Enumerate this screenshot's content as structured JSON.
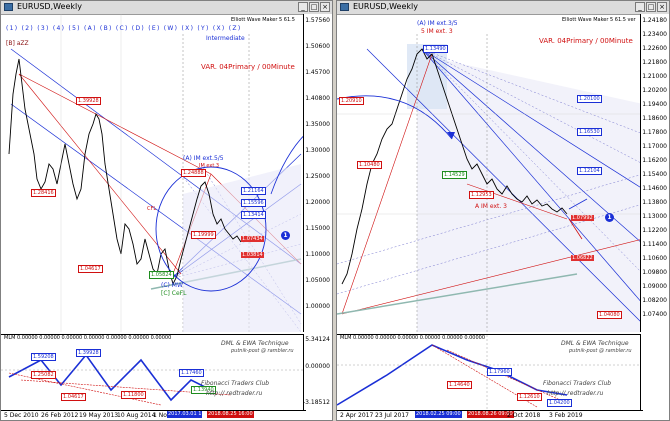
{
  "colors": {
    "blue": "#1a2fd6",
    "red": "#d01010",
    "green": "#1e8c1e",
    "teal": "#8fb8b0",
    "darkred": "#8a1010",
    "navy": "#1a1a8c"
  },
  "left": {
    "title": "EURUSD,Weekly",
    "elliott": "Elliott Wave Maker 5 61.5",
    "wave_labels": "(1) (2) (3) (4) (5) (A) (B) (C) (D) (E) (W) (X) (Y) (X) (Z)",
    "intermediate": "Intermediate",
    "top_marker": "[B] aZZ",
    "var": "VAR. 04Primary / 00Minute",
    "im_label": "(A) IM ext.5/5",
    "im_label2": "IM ext.3",
    "cmw": "(C) MW",
    "cefl": "[C] CeFL",
    "cfl": "CFL",
    "price_axis": [
      "1.57560",
      "1.50600",
      "1.45700",
      "1.40800",
      "1.35000",
      "1.30000",
      "1.25000",
      "1.20000",
      "1.15000",
      "1.10000",
      "1.05000",
      "1.00000"
    ],
    "price_labels": {
      "p1": "1.39928",
      "p2": "1.28416",
      "p3": "1.24888",
      "p4": "1.21164",
      "p5": "1.15596",
      "p6": "1.04617",
      "p7": "1.13414",
      "p8": "1.05824",
      "p9": "1.07434",
      "p10": "1.03814",
      "p11": "1.19999"
    },
    "indicator": "MLM 0.00000 0.00000 0.00000 0.00000 0.00000 0.00000 0.00000",
    "ind_axis": [
      "5.34124",
      "0.00000",
      "-3.18512"
    ],
    "osc_labels": {
      "o1": "1.59208",
      "o2": "1.39928",
      "o3": "1.17460",
      "o4": "1.13940",
      "o5": "1.25082",
      "o6": "1.04617",
      "o7": "1.11800"
    },
    "watermark1": "DML & EWA Technique",
    "watermark2": "putnik-post @ rambler.ru",
    "club": "Fibonacci Traders Club",
    "site": "http:// redtrader.ru",
    "dates": [
      "5 Dec 2010",
      "26 Feb 2012",
      "19 May 2013",
      "10 Aug 2014",
      "1 No"
    ],
    "date_hl1": "2017.03.01 1",
    "date_hl2": "2018.08.25 16:00",
    "marker1": "1"
  },
  "right": {
    "title": "EURUSD,Weekly",
    "elliott": "Elliott Wave Maker 5 61.5 ver",
    "im_label": "(A) IM ext.3/5",
    "im_sub": "5 IM ext. 3",
    "var": "VAR. 04Primary / 00Minute",
    "a_label": "A IM ext. 3",
    "price_axis": [
      "1.24180",
      "1.23400",
      "1.22600",
      "1.21800",
      "1.21000",
      "1.20200",
      "1.19400",
      "1.18600",
      "1.17800",
      "1.17000",
      "1.16200",
      "1.15400",
      "1.14600",
      "1.13800",
      "1.13000",
      "1.12200",
      "1.11400",
      "1.10600",
      "1.09800",
      "1.09000",
      "1.08200",
      "1.07400"
    ],
    "price_labels": {
      "p1": "1.20910",
      "p2": "1.20100",
      "p3": "1.16530",
      "p4": "1.12953",
      "p5": "1.14529",
      "p6": "1.10480",
      "p7": "1.13490",
      "p8": "1.12104",
      "p9": "1.07992",
      "p10": "1.06822",
      "p11": "1.04080"
    },
    "indicator": "MLM 0.00000 0.00000 0.00000 0.00000 0.00000 0.00000",
    "watermark1": "DML & EWA Technique",
    "watermark2": "putnik-post @ rambler.ru",
    "club": "Fibonacci Traders Club",
    "site": "http:// redtrader.ru",
    "dates": [
      "2 Apr 2017",
      "23 Jul 2017",
      "2018.02.25 09:00",
      "2 Oct 2018",
      "3 Feb 2019"
    ],
    "date_hl1": "2018.02.25 09:00",
    "date_hl2": "2018.08.26 09:00",
    "marker1": "1",
    "osc_labels": {
      "o1": "1.17960",
      "o2": "1.14640",
      "o3": "1.12610",
      "o4": "1.04200"
    }
  },
  "window_buttons": [
    "_",
    "□",
    "×"
  ]
}
